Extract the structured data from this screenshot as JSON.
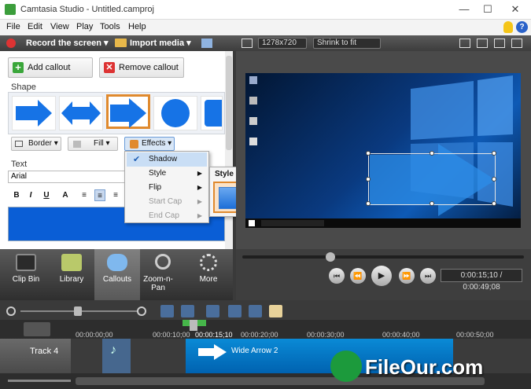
{
  "window": {
    "title": "Camtasia Studio - Untitled.camproj",
    "minimize": "—",
    "maximize": "☐",
    "close": "✕"
  },
  "menu": [
    "File",
    "Edit",
    "View",
    "Play",
    "Tools",
    "Help"
  ],
  "toolbar": {
    "record": "Record the screen ▾",
    "import": "Import media ▾"
  },
  "tasks": {
    "add_callout": "Add callout",
    "remove_callout": "Remove callout",
    "shape_label": "Shape",
    "border": "Border ▾",
    "fill": "Fill ▾",
    "effects": "Effects ▾",
    "text_label": "Text",
    "font": "Arial",
    "format_buttons": [
      "B",
      "I",
      "U",
      "A",
      "≡",
      "≡",
      "≡"
    ]
  },
  "effects_menu": {
    "items": [
      {
        "label": "Shadow",
        "checked": true
      },
      {
        "label": "Style"
      },
      {
        "label": "Flip"
      },
      {
        "label": "Start Cap"
      },
      {
        "label": "End Cap"
      }
    ],
    "style_title": "Style"
  },
  "left_tabs": [
    "Clip Bin",
    "Library",
    "Callouts",
    "Zoom-n-Pan",
    "More"
  ],
  "preview": {
    "resolution": "1278x720",
    "zoom": "Shrink to fit",
    "timecode": "0:00:15;10 / 0:00:49;08"
  },
  "timeline": {
    "ruler_ticks": [
      "00:00:00;00",
      "00:00:10;00",
      "00:00:15;10",
      "00:00:20;00",
      "00:00:30;00",
      "00:00:40;00",
      "00:00:50;00"
    ],
    "track": "Track 4",
    "clip": "Wide Arrow 2"
  },
  "watermark": "FileOur.com",
  "colors": {
    "accent": "#e08a2e",
    "selection_blue": "#0a5ed6"
  }
}
